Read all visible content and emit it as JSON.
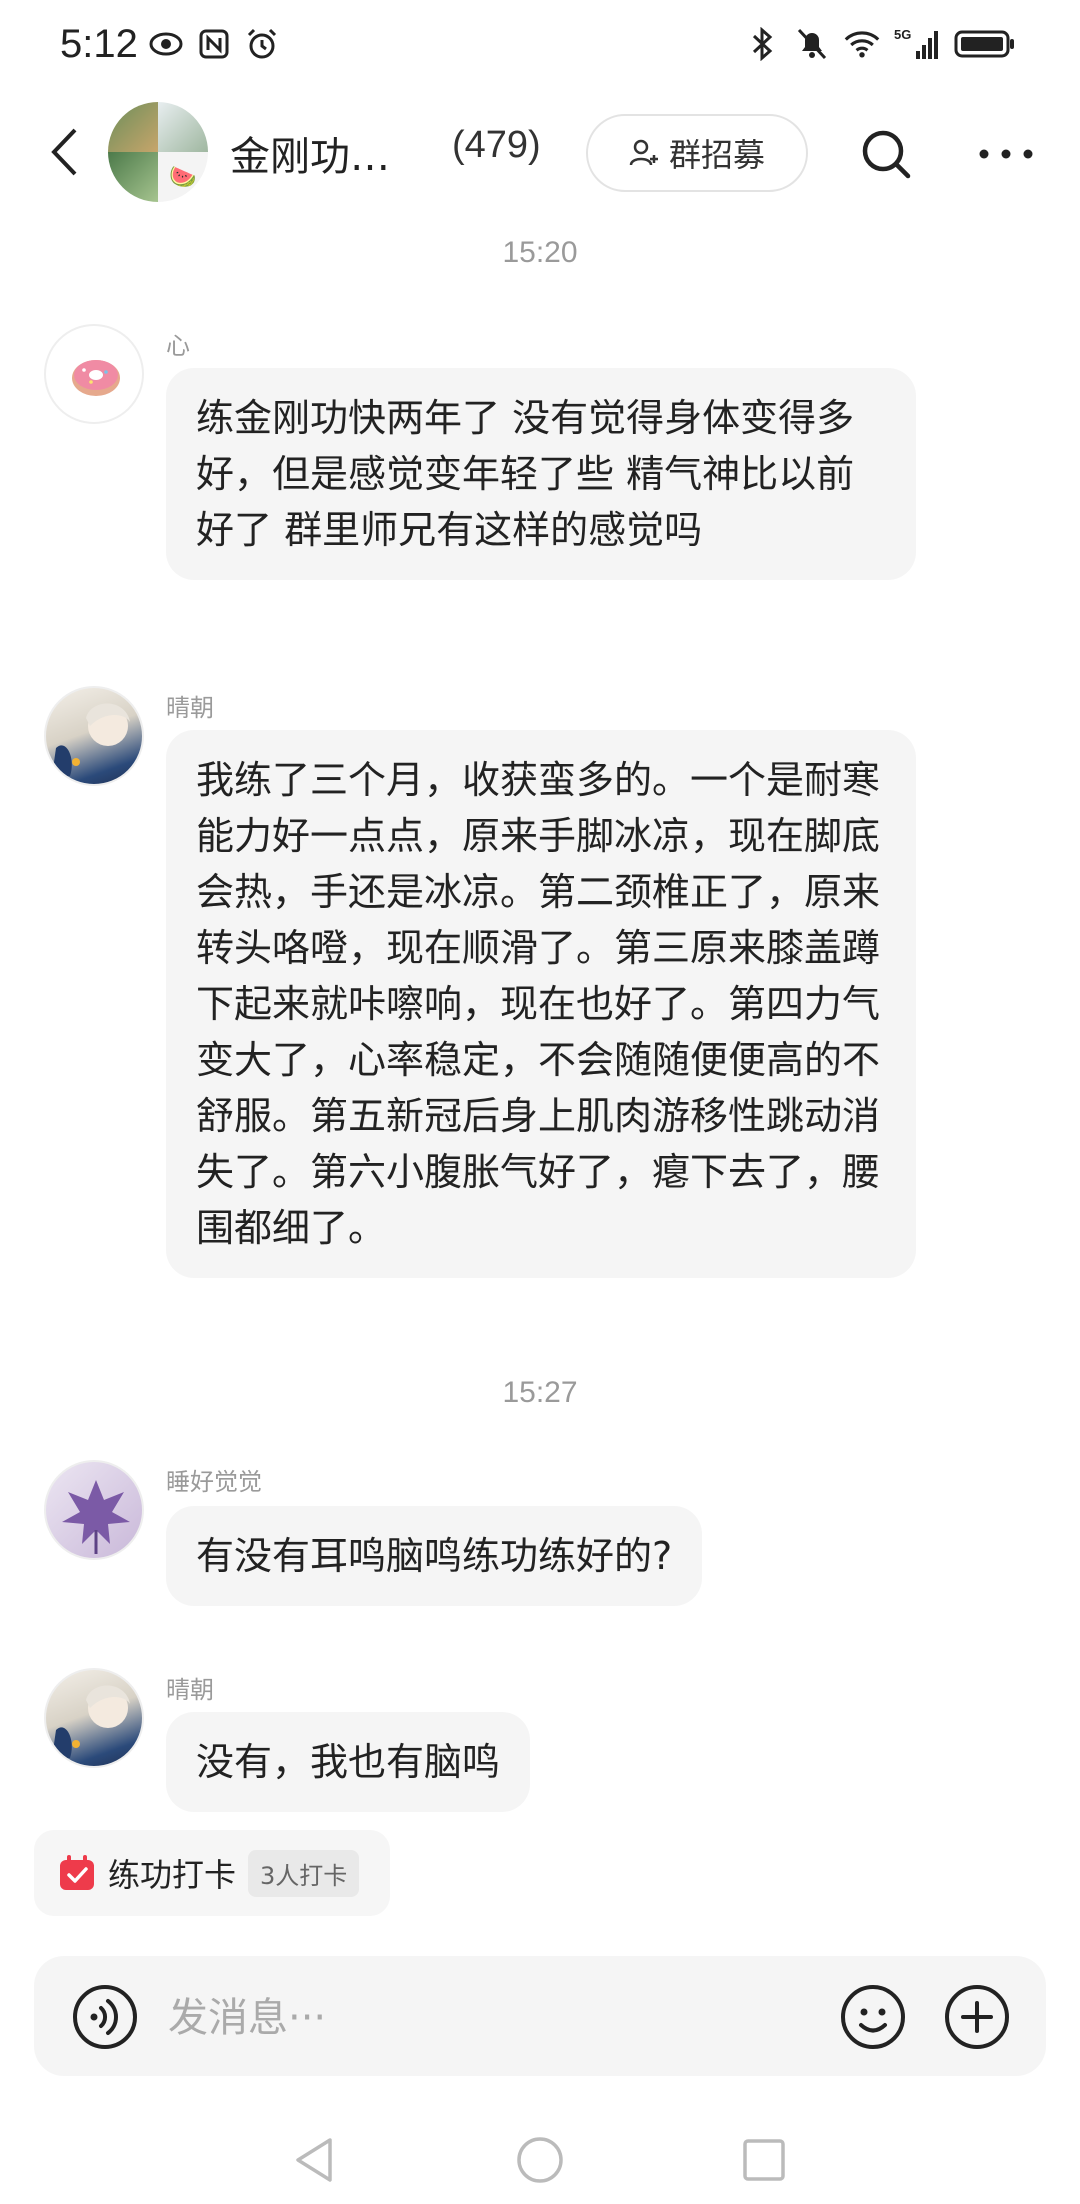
{
  "status_bar": {
    "time": "5:12",
    "left_icons": [
      "eye-icon",
      "nfc-icon",
      "alarm-icon"
    ],
    "right_icons": [
      "bluetooth-icon",
      "mute-icon",
      "wifi-icon",
      "signal-5g-icon",
      "battery-icon"
    ],
    "network": "5G"
  },
  "header": {
    "group_name": "金刚功…",
    "member_count": "(479)",
    "recruit_label": "群招募"
  },
  "timestamps": [
    "15:20",
    "15:27"
  ],
  "messages": [
    {
      "sender": "心",
      "text": "练金刚功快两年了 没有觉得身体变得多好，但是感觉变年轻了些 精气神比以前好了 群里师兄有这样的感觉吗"
    },
    {
      "sender": "晴朝",
      "text": "我练了三个月，收获蛮多的。一个是耐寒能力好一点点，原来手脚冰凉，现在脚底会热，手还是冰凉。第二颈椎正了，原来转头咯噔，现在顺滑了。第三原来膝盖蹲下起来就咔嚓响，现在也好了。第四力气变大了，心率稳定，不会随随便便高的不舒服。第五新冠后身上肌肉游移性跳动消失了。第六小腹胀气好了，瘪下去了，腰围都细了。"
    },
    {
      "sender": "睡好觉觉",
      "text": "有没有耳鸣脑鸣练功练好的?"
    },
    {
      "sender": "晴朝",
      "text": "没有，我也有脑鸣"
    }
  ],
  "checkin": {
    "label": "练功打卡",
    "count": "3人打卡"
  },
  "input": {
    "placeholder": "发消息···"
  },
  "colors": {
    "bubble_bg": "#f5f5f5",
    "accent_red": "#ee3b4b",
    "muted_text": "#9a9a9a"
  }
}
